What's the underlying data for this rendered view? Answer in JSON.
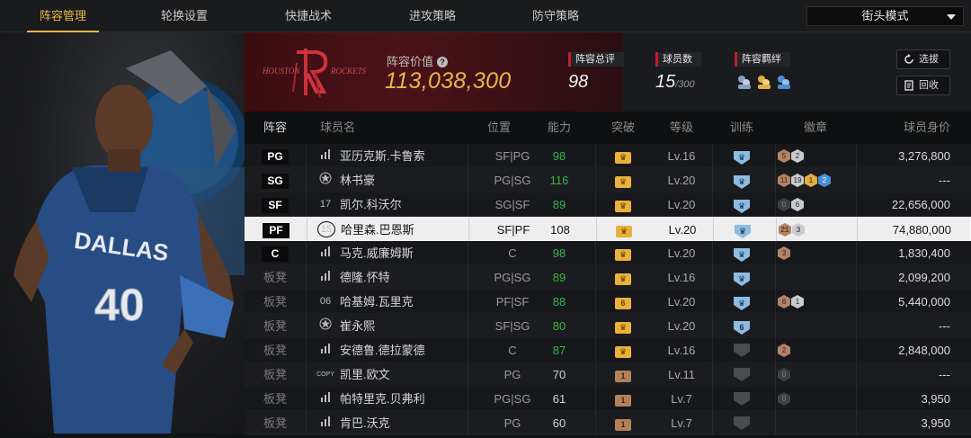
{
  "tabs": [
    {
      "label": "阵容管理",
      "active": true
    },
    {
      "label": "轮换设置",
      "active": false
    },
    {
      "label": "快捷战术",
      "active": false
    },
    {
      "label": "进攻策略",
      "active": false
    },
    {
      "label": "防守策略",
      "active": false
    }
  ],
  "mode": {
    "label": "街头模式"
  },
  "team": {
    "logo_text": "HOUSTON ROCKETS",
    "value_label": "阵容价值",
    "value": "113,038,300"
  },
  "stats": {
    "overall_label": "阵容总评",
    "overall_value": "98",
    "count_label": "球员数",
    "count_value": "15",
    "count_max": "/300",
    "bond_label": "阵容羁绊"
  },
  "buttons": {
    "select": "选拔",
    "recycle": "回收"
  },
  "columns": {
    "lineup": "阵容",
    "player": "球员名",
    "position": "位置",
    "ability": "能力",
    "breakthrough": "突破",
    "level": "等级",
    "training": "训练",
    "badges": "徽章",
    "worth": "球员身价"
  },
  "colors": {
    "accent": "#e7b64a",
    "team_red": "#c21d2a",
    "ability_green": "#3ab54a"
  },
  "players": [
    {
      "slot": "PG",
      "jersey_icon": "stats-icon",
      "jersey": "",
      "name": "亚历克斯.卡鲁索",
      "position": "SF|PG",
      "ability": "98",
      "ability_green": true,
      "break": "crown",
      "level": "Lv.16",
      "train": "shield",
      "train_num": "",
      "badges": [
        {
          "t": "bronze",
          "n": "5"
        },
        {
          "t": "silver",
          "n": "2"
        }
      ],
      "worth": "3,276,800"
    },
    {
      "slot": "SG",
      "jersey_icon": "star-icon",
      "jersey": "",
      "name": "林书豪",
      "position": "PG|SG",
      "ability": "116",
      "ability_green": true,
      "break": "crown",
      "level": "Lv.20",
      "train": "shield",
      "train_num": "",
      "badges": [
        {
          "t": "bronze",
          "n": "11"
        },
        {
          "t": "silver",
          "n": "19"
        },
        {
          "t": "gold",
          "n": "1"
        },
        {
          "t": "blue",
          "n": "2"
        }
      ],
      "worth": "---"
    },
    {
      "slot": "SF",
      "jersey_icon": "",
      "jersey": "17",
      "name": "凯尔.科沃尔",
      "position": "SG|SF",
      "ability": "89",
      "ability_green": true,
      "break": "crown",
      "level": "Lv.20",
      "train": "shield",
      "train_num": "",
      "badges": [
        {
          "t": "dark",
          "n": "0"
        },
        {
          "t": "silver",
          "n": "6"
        }
      ],
      "worth": "22,656,000"
    },
    {
      "slot": "PF",
      "jersey_icon": "",
      "jersey": "15",
      "name": "哈里森.巴恩斯",
      "position": "SF|PF",
      "ability": "108",
      "ability_green": false,
      "break": "crown",
      "level": "Lv.20",
      "train": "shield",
      "train_num": "",
      "badges": [
        {
          "t": "bronze",
          "n": "21"
        },
        {
          "t": "silver",
          "n": "3"
        }
      ],
      "worth": "74,880,000",
      "selected": true
    },
    {
      "slot": "C",
      "jersey_icon": "stats-icon",
      "jersey": "",
      "name": "马克.威廉姆斯",
      "position": "C",
      "ability": "98",
      "ability_green": true,
      "break": "crown",
      "level": "Lv.20",
      "train": "shield",
      "train_num": "",
      "badges": [
        {
          "t": "bronze",
          "n": "3"
        }
      ],
      "worth": "1,830,400"
    },
    {
      "slot": "板凳",
      "jersey_icon": "stats-icon",
      "jersey": "",
      "name": "德隆.怀特",
      "position": "PG|SG",
      "ability": "89",
      "ability_green": true,
      "break": "crown",
      "level": "Lv.16",
      "train": "shield",
      "train_num": "",
      "badges": [],
      "worth": "2,099,200"
    },
    {
      "slot": "板凳",
      "jersey_icon": "",
      "jersey": "06",
      "name": "哈基姆.瓦里克",
      "position": "PF|SF",
      "ability": "88",
      "ability_green": true,
      "break": "crown-6",
      "level": "Lv.20",
      "train": "shield",
      "train_num": "",
      "badges": [
        {
          "t": "bronze",
          "n": "6"
        },
        {
          "t": "silver",
          "n": "1"
        }
      ],
      "worth": "5,440,000"
    },
    {
      "slot": "板凳",
      "jersey_icon": "star-icon",
      "jersey": "",
      "name": "崔永熙",
      "position": "SF|SG",
      "ability": "80",
      "ability_green": true,
      "break": "crown",
      "level": "Lv.20",
      "train": "shield",
      "train_num": "6",
      "badges": [],
      "worth": "---"
    },
    {
      "slot": "板凳",
      "jersey_icon": "stats-icon",
      "jersey": "",
      "name": "安德鲁.德拉蒙德",
      "position": "C",
      "ability": "87",
      "ability_green": true,
      "break": "crown",
      "level": "Lv.16",
      "train": "dark",
      "train_num": "",
      "badges": [
        {
          "t": "bronze",
          "n": "2"
        }
      ],
      "worth": "2,848,000"
    },
    {
      "slot": "板凳",
      "jersey_icon": "copy-icon",
      "jersey": "COPY",
      "name": "凯里.欧文",
      "position": "PG",
      "ability": "70",
      "ability_green": false,
      "break": "brown-1",
      "level": "Lv.11",
      "train": "dark",
      "train_num": "",
      "badges": [
        {
          "t": "dark",
          "n": "0"
        }
      ],
      "worth": "---"
    },
    {
      "slot": "板凳",
      "jersey_icon": "stats-icon",
      "jersey": "",
      "name": "帕特里克.贝弗利",
      "position": "PG|SG",
      "ability": "61",
      "ability_green": false,
      "break": "brown-1",
      "level": "Lv.7",
      "train": "dark",
      "train_num": "",
      "badges": [
        {
          "t": "dark",
          "n": "0"
        }
      ],
      "worth": "3,950"
    },
    {
      "slot": "板凳",
      "jersey_icon": "stats-icon",
      "jersey": "",
      "name": "肯巴.沃克",
      "position": "PG",
      "ability": "60",
      "ability_green": false,
      "break": "brown-1",
      "level": "Lv.7",
      "train": "dark",
      "train_num": "",
      "badges": [],
      "worth": "3,950"
    }
  ]
}
